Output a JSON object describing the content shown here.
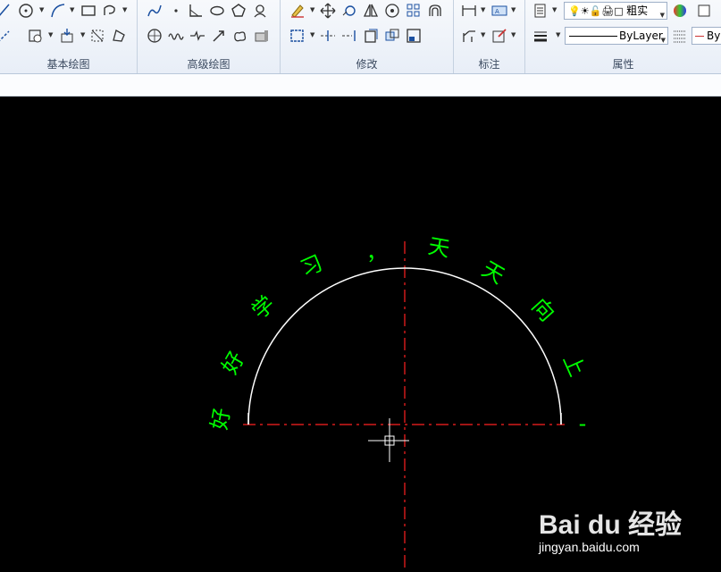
{
  "ribbon": {
    "panels": {
      "basic_draw": "基本绘图",
      "advanced_draw": "高级绘图",
      "modify": "修改",
      "annotate": "标注",
      "properties": "属性"
    },
    "layer_combo": "粗实",
    "linetype_combo": "ByLayer",
    "lineweight_combo": "By"
  },
  "canvas": {
    "arc_text": [
      "好",
      "好",
      "学",
      "习",
      "，",
      "天",
      "天",
      "向",
      "上"
    ],
    "trailing_text": "-",
    "colors": {
      "text": "#00ff00",
      "arc": "#ffffff",
      "centerline": "#ff0000",
      "crosshair": "#ffffff"
    }
  },
  "watermark": {
    "logo": "Bai du 经验",
    "url": "jingyan.baidu.com"
  }
}
